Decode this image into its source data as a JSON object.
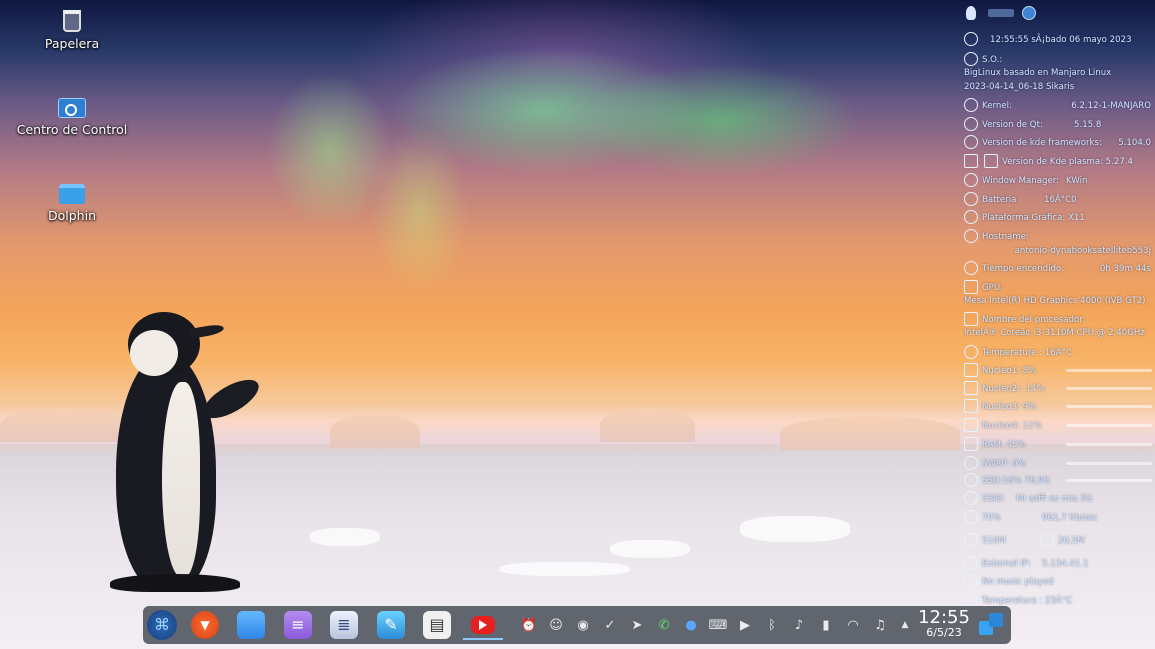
{
  "desktop": {
    "icons": [
      {
        "label": "Papelera",
        "icon": "trash-icon"
      },
      {
        "label": "Centro de Control",
        "icon": "control-center-icon"
      },
      {
        "label": "Dolphin",
        "icon": "folder-icon"
      }
    ]
  },
  "conky": {
    "datetime": "12:55:55 sÃ¡bado 06 mayo 2023",
    "os_label": "S.O.:",
    "os_name": "BigLinux basado en Manjaro Linux",
    "os_build": "2023-04-14_06-18 Sikaris",
    "kernel": {
      "label": "Kernel:",
      "value": "6.2.12-1-MANJARO"
    },
    "qt": {
      "label": "Version de Qt:",
      "value": "5.15.8"
    },
    "kf": {
      "label": "Version de kde frameworks:",
      "value": "5.104.0"
    },
    "plasma": {
      "label": "Version de Kde plasma:",
      "value": "5.27.4"
    },
    "wm": {
      "label": "Window Manager:",
      "value": "KWin"
    },
    "battery": {
      "label": "Batteria",
      "value": "16Â°C0"
    },
    "graphics": {
      "label": "Plataforma Grafica:",
      "value": "X11"
    },
    "hostname": {
      "label": "Hostname:",
      "value": "antonio-dynabooksatelliteb553j"
    },
    "uptime": {
      "label": "Tiempo encendido:",
      "value": "0h 39m 44s"
    },
    "gpu": {
      "label": "GPU:",
      "value": "Mesa Intel(R) HD Graphics 4000 (IVB GT2)"
    },
    "cpu": {
      "label": "Nombre del procesador:",
      "value": "IntelÂ® Coreâ¢ i3-3110M CPU @ 2.40GHz"
    },
    "cpu_temp": "Temperature : 16Â°C",
    "cores": [
      {
        "label": "Nucleo1: 8%",
        "level": 0.08
      },
      {
        "label": "Nucleo2:: 14%",
        "level": 0.14
      },
      {
        "label": "Nucleo3: 9%",
        "level": 0.09
      },
      {
        "label": "Nucleo4: 11%",
        "level": 0.11
      }
    ],
    "ram": {
      "label": "RAM: 45%",
      "level": 0.45
    },
    "swap": {
      "label": "SWAP: 0%",
      "level": 0.0
    },
    "ssd": {
      "label": "SSD:16% 76,9G",
      "level": 0.16
    },
    "ssid": {
      "label": "SSID:",
      "value": "Mi wiffi es mia 5G"
    },
    "signal": "70%",
    "speed": "961,7 Kb/sec",
    "down": "510M",
    "up": "20,5M",
    "external_ip": {
      "label": "External IP:",
      "value": "5.134.41.1"
    },
    "music": "No music played",
    "temperature2": "Temperatura : 23Â°C"
  },
  "taskbar": {
    "apps": [
      {
        "name": "biglinux-logo-icon",
        "glyph": "⌘"
      },
      {
        "name": "brave-browser-icon",
        "glyph": "▼"
      },
      {
        "name": "file-manager-icon",
        "glyph": ""
      },
      {
        "name": "notes-icon",
        "glyph": "≡"
      },
      {
        "name": "documents-icon",
        "glyph": "≣"
      },
      {
        "name": "text-editor-icon",
        "glyph": "✎"
      },
      {
        "name": "document-viewer-icon",
        "glyph": "▤"
      },
      {
        "name": "youtube-icon",
        "glyph": ""
      }
    ],
    "tray": [
      {
        "name": "alarm-icon",
        "glyph": "⏰"
      },
      {
        "name": "user-icon",
        "glyph": "☺"
      },
      {
        "name": "discord-icon",
        "glyph": "◉"
      },
      {
        "name": "check-icon",
        "glyph": "✓"
      },
      {
        "name": "telegram-icon",
        "glyph": "➤"
      },
      {
        "name": "whatsapp-icon",
        "glyph": "✆"
      },
      {
        "name": "lock-icon",
        "glyph": "●"
      },
      {
        "name": "keyboard-icon",
        "glyph": "⌨"
      },
      {
        "name": "media-play-icon",
        "glyph": "▶"
      },
      {
        "name": "bluetooth-icon",
        "glyph": "ᛒ"
      },
      {
        "name": "volume-icon",
        "glyph": "♪"
      },
      {
        "name": "battery-icon",
        "glyph": "▮"
      },
      {
        "name": "wifi-icon",
        "glyph": "◠"
      },
      {
        "name": "speaker-icon",
        "glyph": "♫"
      },
      {
        "name": "expand-tray-icon",
        "glyph": "▲"
      }
    ],
    "clock_time": "12:55",
    "clock_date": "6/5/23"
  }
}
